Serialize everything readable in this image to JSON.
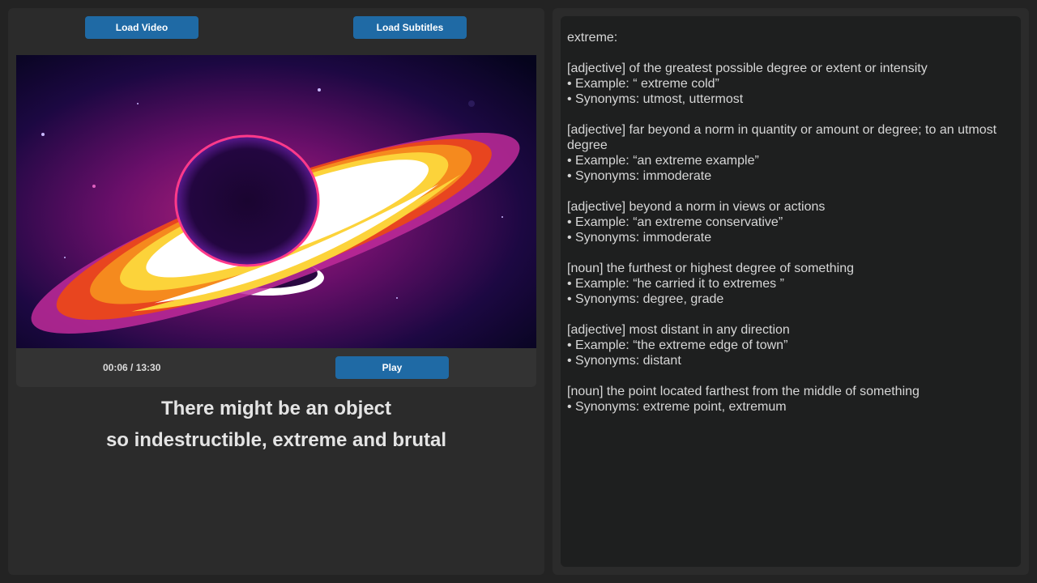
{
  "app": {
    "load_video_label": "Load Video",
    "load_subtitles_label": "Load Subtitles",
    "accent_color": "#1f6aa5"
  },
  "player": {
    "time": "00:06 / 13:30",
    "play_label": "Play",
    "frame_description_icon": "black-hole-frame"
  },
  "subtitles": {
    "line1": "There might be an object",
    "line2": "so indestructible, extreme and brutal"
  },
  "dictionary": {
    "word": "extreme:",
    "senses": [
      {
        "definition": "[adjective] of the greatest possible degree or extent or intensity",
        "example": "• Example: “ extreme cold”",
        "synonyms": "• Synonyms: utmost, uttermost"
      },
      {
        "definition": "[adjective] far beyond a norm in quantity or amount or degree; to an utmost degree",
        "example": "• Example: “an extreme example”",
        "synonyms": "• Synonyms: immoderate"
      },
      {
        "definition": "[adjective] beyond a norm in views or actions",
        "example": "• Example: “an extreme conservative”",
        "synonyms": "• Synonyms: immoderate"
      },
      {
        "definition": "[noun] the furthest or highest degree of something",
        "example": "• Example: “he carried it to extremes ”",
        "synonyms": "• Synonyms: degree, grade"
      },
      {
        "definition": "[adjective] most distant in any direction",
        "example": "• Example: “the extreme edge of town”",
        "synonyms": "• Synonyms: distant"
      },
      {
        "definition": "[noun] the point located farthest from the middle of something",
        "synonyms": "• Synonyms: extreme point, extremum"
      }
    ]
  }
}
